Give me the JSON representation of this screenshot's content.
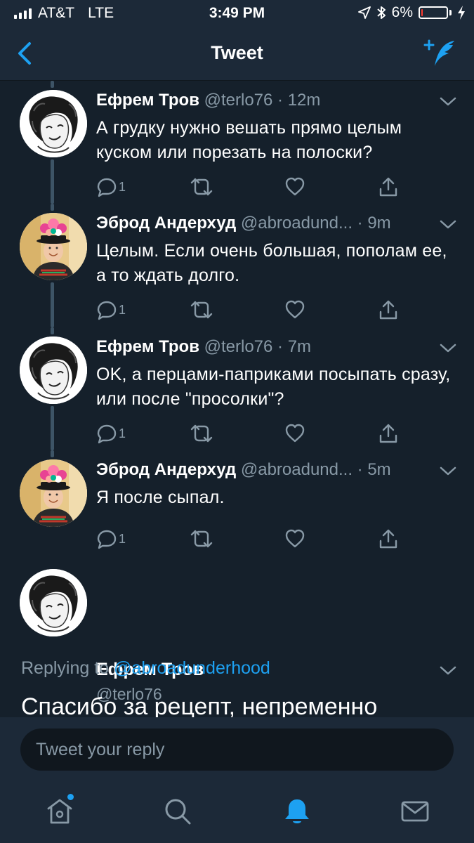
{
  "status_bar": {
    "carrier": "AT&T",
    "network": "LTE",
    "time": "3:49 PM",
    "battery_percent": "6%",
    "battery_level": 0.06,
    "icons": [
      "signal-icon",
      "location-arrow-icon",
      "bluetooth-icon",
      "battery-icon",
      "charging-bolt-icon"
    ]
  },
  "nav": {
    "title": "Tweet",
    "back_icon": "back-chevron-icon",
    "compose_icon": "compose-tweet-icon"
  },
  "colors": {
    "background": "#15202b",
    "bar": "#1c2938",
    "accent": "#1da1f2",
    "secondary_text": "#8899a6",
    "battery_low": "#ff3b30"
  },
  "thread": [
    {
      "name": "Ефрем Тров",
      "handle": "@terlo76",
      "time": "· 12m",
      "text": "А грудку нужно вешать прямо целым куском или порезать на полоски?",
      "reply_count": "1"
    },
    {
      "name": "Эброд Андерхуд",
      "handle": "@abroadund...",
      "time": "· 9m",
      "text": "Целым. Если очень большая, пополам ее, а то ждать долго.",
      "reply_count": "1"
    },
    {
      "name": "Ефрем Тров",
      "handle": "@terlo76",
      "time": "· 7m",
      "text": "OK, а перцами-паприками посыпать сразу, или после \"просолки\"?",
      "reply_count": "1"
    },
    {
      "name": "Эброд Андерхуд",
      "handle": "@abroadund...",
      "time": "· 5m",
      "text": "Я после сыпал.",
      "reply_count": "1"
    }
  ],
  "main_tweet": {
    "name": "Ефрем Тров",
    "handle": "@terlo76",
    "replying_prefix": "Replying to",
    "replying_handle": "@abroadunderhood",
    "text": "Спасибо за рецепт, непременно"
  },
  "reply_bar": {
    "placeholder": "Tweet your reply"
  },
  "tabs": [
    {
      "icon": "home-icon",
      "active": false,
      "has_dot": true
    },
    {
      "icon": "search-icon",
      "active": false
    },
    {
      "icon": "notifications-bell-icon",
      "active": true
    },
    {
      "icon": "messages-envelope-icon",
      "active": false
    }
  ]
}
